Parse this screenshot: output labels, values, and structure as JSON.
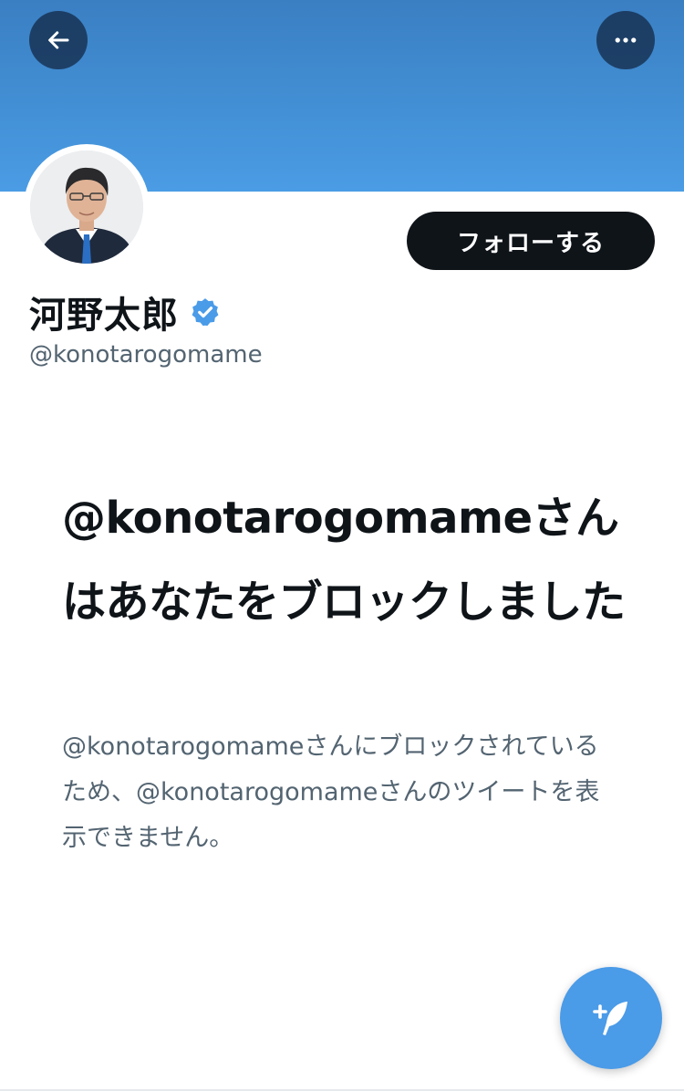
{
  "header": {
    "back_icon": "arrow-left-icon",
    "more_icon": "more-horizontal-icon",
    "banner_color": "#4a9ce4"
  },
  "profile": {
    "display_name": "河野太郎",
    "handle": "@konotarogomame",
    "verified": true,
    "verified_color": "#4a9be8",
    "follow_button_label": "フォローする"
  },
  "blocked": {
    "title": "@konotarogomameさんはあなたをブロックしました",
    "description": "@konotarogomameさんにブロックされているため、@konotarogomameさんのツイートを表示できません。"
  },
  "fab": {
    "icon": "compose-tweet-icon",
    "color": "#4a9be8"
  }
}
